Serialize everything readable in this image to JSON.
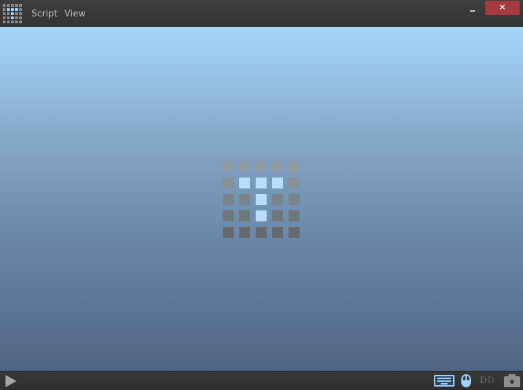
{
  "menu": {
    "items": [
      {
        "label": "Script"
      },
      {
        "label": "View"
      }
    ]
  },
  "window": {
    "minimize_label": "–",
    "close_label": "✕",
    "close_color": "#a53b3f"
  },
  "canvas": {
    "gradient_top": "#a5d6fb",
    "gradient_bottom": "#4f6482",
    "loader_active_color": "#b6ddfc"
  },
  "status": {
    "dd_label": "DD",
    "accent_color": "#9fd3ff",
    "icons": [
      "play-icon",
      "keyboard-icon",
      "mouse-icon",
      "camera-icon"
    ]
  }
}
